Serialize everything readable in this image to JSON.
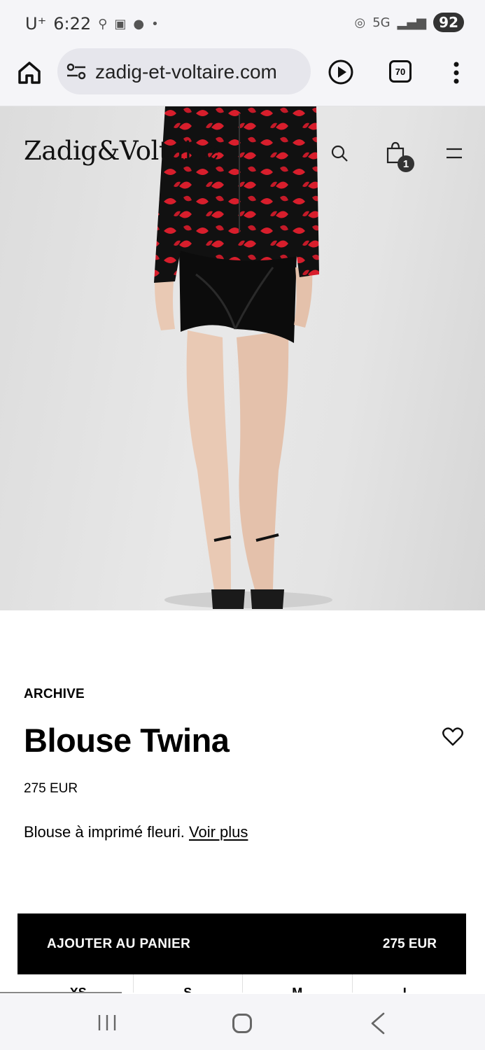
{
  "status_bar": {
    "carrier": "U⁺",
    "time": "6:22",
    "network": "5G",
    "battery": "92"
  },
  "browser": {
    "url": "zadig-et-voltaire.com",
    "tab_count": "70"
  },
  "site": {
    "logo": "Zadig&Voltaire",
    "cart_count": "1"
  },
  "product": {
    "collection": "ARCHIVE",
    "title": "Blouse Twina",
    "price": "275 EUR",
    "description": "Blouse à imprimé fleuri.",
    "see_more": "Voir plus"
  },
  "cart_button": {
    "label": "AJOUTER AU PANIER",
    "price": "275 EUR"
  },
  "sizes": [
    "XS",
    "S",
    "M",
    "L"
  ],
  "colors": {
    "accent": "#000000",
    "blouse_red": "#d81e2c",
    "background": "#ffffff"
  }
}
